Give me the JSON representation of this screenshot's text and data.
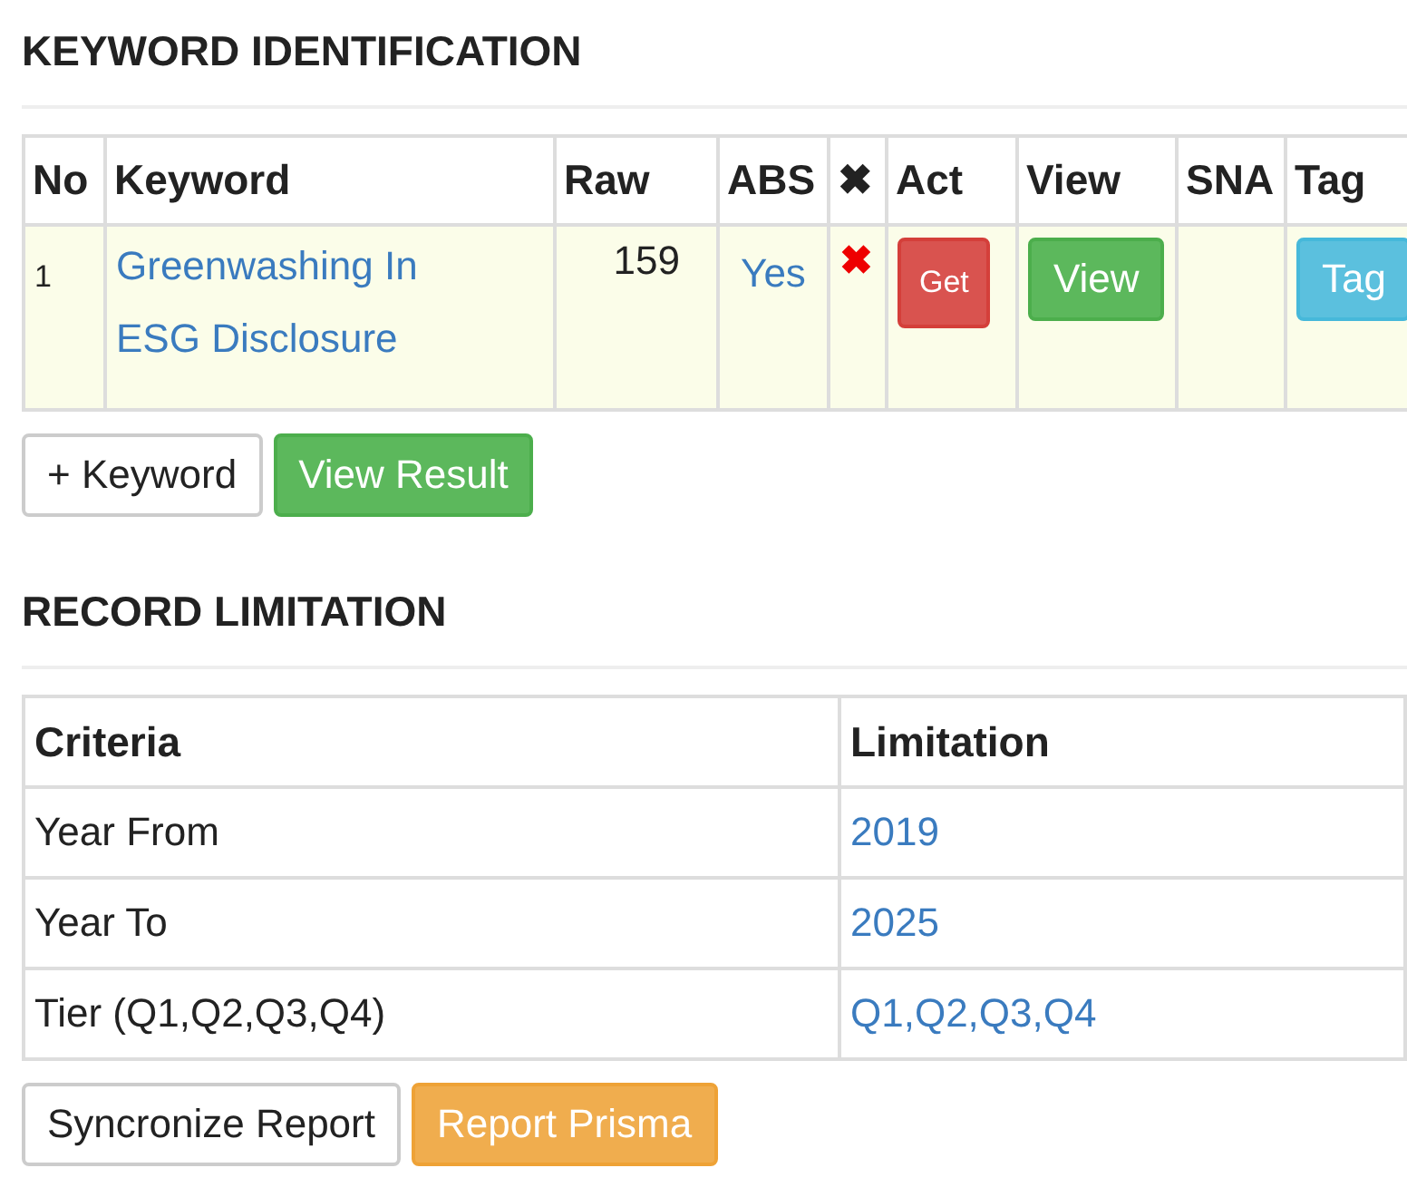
{
  "keyword_section": {
    "title": "KEYWORD IDENTIFICATION",
    "columns": [
      "No",
      "Keyword",
      "Raw",
      "ABS",
      "✖",
      "Act",
      "View",
      "SNA",
      "Tag"
    ],
    "rows": [
      {
        "no": "1",
        "keyword": "Greenwashing In ESG Disclosure",
        "raw": "159",
        "abs": "Yes",
        "remove": "✖",
        "act": {
          "label": "Get",
          "kind": "danger"
        },
        "view": {
          "label": "View",
          "kind": "success"
        },
        "tag": {
          "label": "Tag",
          "kind": "info"
        }
      }
    ],
    "buttons": [
      {
        "label": "+ Keyword",
        "kind": "default"
      },
      {
        "label": "View Result",
        "kind": "success"
      }
    ]
  },
  "record_section": {
    "title": "RECORD LIMITATION",
    "columns": [
      "Criteria",
      "Limitation"
    ],
    "rows": [
      {
        "criteria": "Year From",
        "limitation": "2019"
      },
      {
        "criteria": "Year To",
        "limitation": "2025"
      },
      {
        "criteria": "Tier (Q1,Q2,Q3,Q4)",
        "limitation": "Q1,Q2,Q3,Q4"
      }
    ],
    "buttons": [
      {
        "label": "Syncronize Report",
        "kind": "default"
      },
      {
        "label": "Report Prisma",
        "kind": "warning"
      }
    ]
  }
}
